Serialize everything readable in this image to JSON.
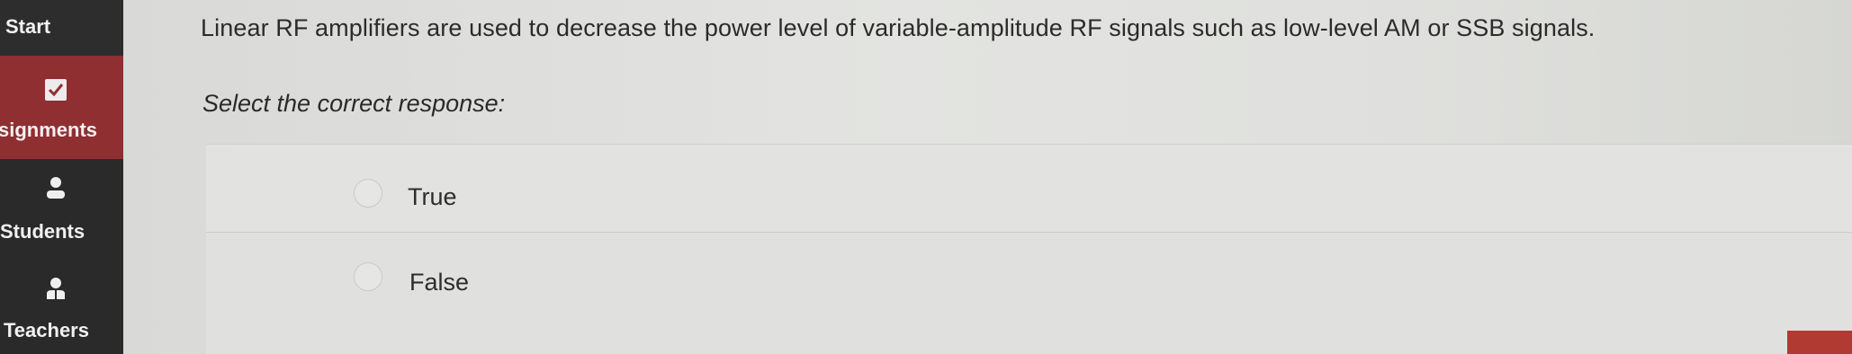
{
  "sidebar": {
    "items": [
      {
        "label": "Start",
        "icon": "none"
      },
      {
        "label": "signments",
        "icon": "checkbox-icon",
        "active": true
      },
      {
        "label": "Students",
        "icon": "person-icon"
      },
      {
        "label": "Teachers",
        "icon": "teacher-icon"
      }
    ]
  },
  "question": {
    "text": "Linear RF amplifiers are used to decrease the power level of variable-amplitude RF signals such as low-level AM or SSB signals.",
    "prompt": "Select the correct response:",
    "options": [
      {
        "label": "True",
        "selected": false
      },
      {
        "label": "False",
        "selected": false
      }
    ]
  },
  "colors": {
    "sidebar_bg": "#2a2a2a",
    "active_item_bg": "#8f2f32",
    "content_bg": "#e0e1de",
    "corner_accent": "#b13a33"
  }
}
